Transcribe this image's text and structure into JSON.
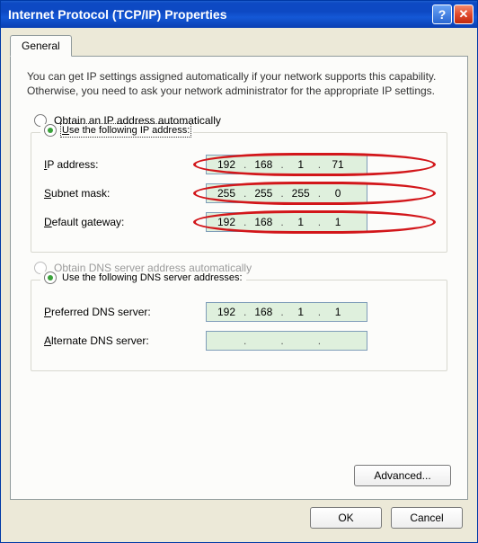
{
  "window": {
    "title": "Internet Protocol (TCP/IP) Properties"
  },
  "tabs": {
    "general": "General"
  },
  "intro": "You can get IP settings assigned automatically if your network supports this capability. Otherwise, you need to ask your network administrator for the appropriate IP settings.",
  "ip": {
    "auto_prefix": "O",
    "auto_rest": "btain an IP address automatically",
    "manual_prefix": "U",
    "manual_rest": "se the following IP address:",
    "addr_prefix": "I",
    "addr_rest": "P address:",
    "addr_o1": "192",
    "addr_o2": "168",
    "addr_o3": "1",
    "addr_o4": "71",
    "mask_prefix": "S",
    "mask_rest": "ubnet mask:",
    "mask_o1": "255",
    "mask_o2": "255",
    "mask_o3": "255",
    "mask_o4": "0",
    "gw_prefix": "D",
    "gw_rest": "efault gateway:",
    "gw_o1": "192",
    "gw_o2": "168",
    "gw_o3": "1",
    "gw_o4": "1"
  },
  "dns": {
    "auto_prefix": "O",
    "auto_rest": "btain DNS server address automatically",
    "manual_prefix": "U",
    "manual_rest": "se the following DNS server addresses:",
    "pref_prefix": "P",
    "pref_rest": "referred DNS server:",
    "pref_o1": "192",
    "pref_o2": "168",
    "pref_o3": "1",
    "pref_o4": "1",
    "alt_prefix": "A",
    "alt_rest": "lternate DNS server:",
    "alt_o1": "",
    "alt_o2": "",
    "alt_o3": "",
    "alt_o4": ""
  },
  "buttons": {
    "advanced": "Advanced...",
    "ok": "OK",
    "cancel": "Cancel"
  }
}
